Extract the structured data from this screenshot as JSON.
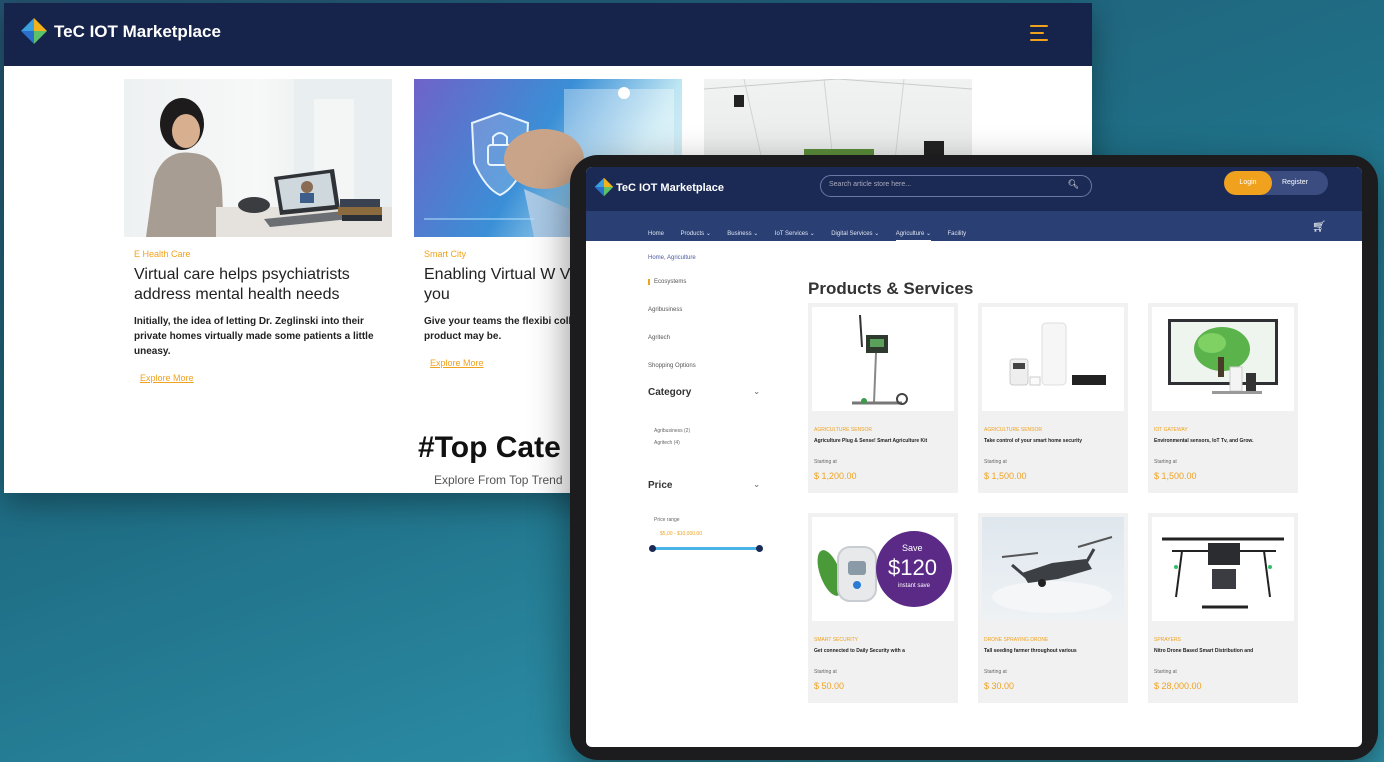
{
  "desktop": {
    "brand": "TeC IOT Marketplace",
    "cards": [
      {
        "category": "E Health Care",
        "title": "Virtual care helps psychiatrists address mental health needs",
        "description": "Initially, the idea of letting Dr. Zeglinski into their private homes virtually made some patients a little uneasy.",
        "link": "Explore More"
      },
      {
        "category": "Smart City",
        "title": "Enabling Virtual W Virtual Care for you",
        "description": "Give your teams the flexibi collaborate and be product may be.",
        "link": "Explore More"
      },
      {
        "category": "",
        "title": "",
        "description": "",
        "link": ""
      }
    ],
    "section_title": "#Top Cate",
    "section_subtitle": "Explore From Top Trend"
  },
  "tablet": {
    "brand": "TeC IOT Marketplace",
    "search_placeholder": "Search article store here...",
    "login": "Login",
    "register": "Register",
    "nav": [
      "Home",
      "Products ⌄",
      "Business ⌄",
      "IoT Services ⌄",
      "Digital Services ⌄",
      "Agriculture ⌄",
      "Facility"
    ],
    "breadcrumb": "Home, Agriculture",
    "sidebar": {
      "items": [
        "Ecosystems",
        "Agribusiness",
        "Agritech",
        "Shopping Options"
      ],
      "category_head": "Category",
      "category_options": [
        "Agribusiness  (2)",
        "Agritech  (4)"
      ],
      "price_head": "Price",
      "price_label": "Price range",
      "price_range": "$5,00 - $10,000.00"
    },
    "products_title": "Products & Services",
    "products": [
      {
        "category": "AGRICULTURE SENSOR",
        "name": "Agriculture Plug & Sense! Smart Agriculture Kit",
        "starting": "Starting at",
        "price": "$ 1,200.00"
      },
      {
        "category": "AGRICULTURE SENSOR",
        "name": "Take control of your smart home security",
        "starting": "Starting at",
        "price": "$ 1,500.00"
      },
      {
        "category": "IOT GATEWAY",
        "name": "Environmental sensors, IoT Tv, and Grow.",
        "starting": "Starting at",
        "price": "$ 1,500.00"
      },
      {
        "category": "SMART SECURITY",
        "name": "Get connected to Daily Security with a",
        "starting": "Starting at",
        "price": "$ 50.00"
      },
      {
        "category": "DRONE SPRAYING DRONE",
        "name": "Tall seeding farmer throughout various",
        "starting": "Starting at",
        "price": "$ 30.00"
      },
      {
        "category": "SPRAYERS",
        "name": "Nitro Drone Based Smart Distribution and",
        "starting": "Starting at",
        "price": "$ 28,000.00"
      }
    ],
    "promo": {
      "line1": "Save",
      "line2": "$120",
      "line3": "instant save"
    }
  },
  "colors": {
    "accent": "#f0a21f",
    "navy": "#16234a",
    "nav": "#2a3f73"
  },
  "icons": {
    "menu": "hamburger-icon",
    "search": "search-icon",
    "cart": "cart-icon",
    "chevron": "chevron-down-icon"
  }
}
